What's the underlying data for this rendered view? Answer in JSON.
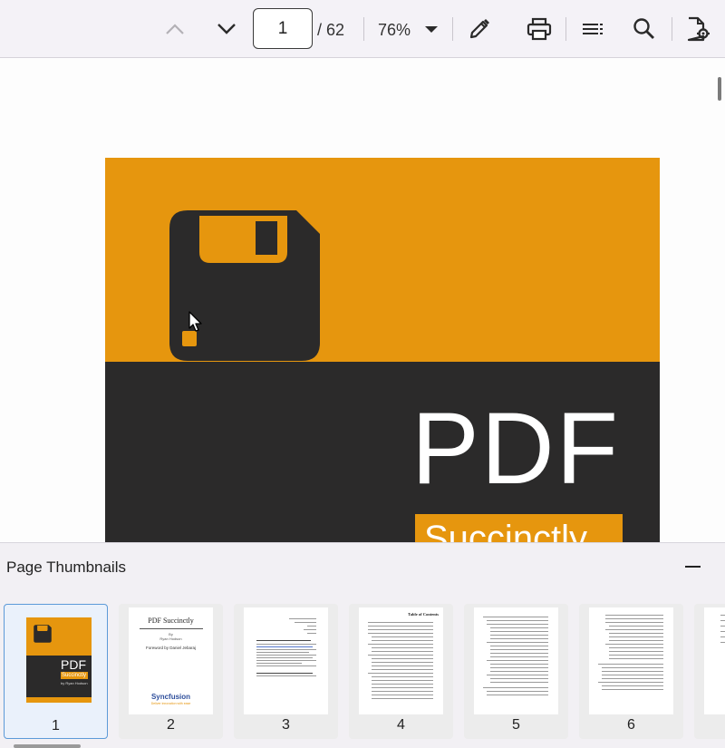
{
  "toolbar": {
    "page_current": "1",
    "page_total": "/ 62",
    "zoom": "76%",
    "icons": [
      "chevron-up-icon",
      "chevron-down-icon",
      "dropdown-arrow-icon",
      "pencil-icon",
      "printer-icon",
      "list-icon",
      "search-icon",
      "document-settings-icon"
    ]
  },
  "cover": {
    "title": "PDF",
    "subtitle": "Succinctly"
  },
  "thumbnails": {
    "title": "Page Thumbnails",
    "pages": [
      {
        "label": "1",
        "selected": true
      },
      {
        "label": "2",
        "selected": false
      },
      {
        "label": "3",
        "selected": false
      },
      {
        "label": "4",
        "selected": false
      },
      {
        "label": "5",
        "selected": false
      },
      {
        "label": "6",
        "selected": false
      }
    ],
    "page1": {
      "title": "PDF",
      "subtitle": "Succinctly",
      "author": "by Ryan Hodson"
    },
    "page2": {
      "title": "PDF Succinctly",
      "by": "By",
      "author": "Ryan Hodson",
      "foreword": "Foreword by Daniel Jebaraj",
      "brand": "Syncfusion",
      "tagline": "Deliver innovation with ease"
    },
    "page4": {
      "heading": "Table of Contents"
    }
  },
  "colors": {
    "accent": "#e6960e",
    "dark": "#2b2a2a",
    "toolbar_bg": "#f4f2f7",
    "selection": "#5c9ad8"
  }
}
